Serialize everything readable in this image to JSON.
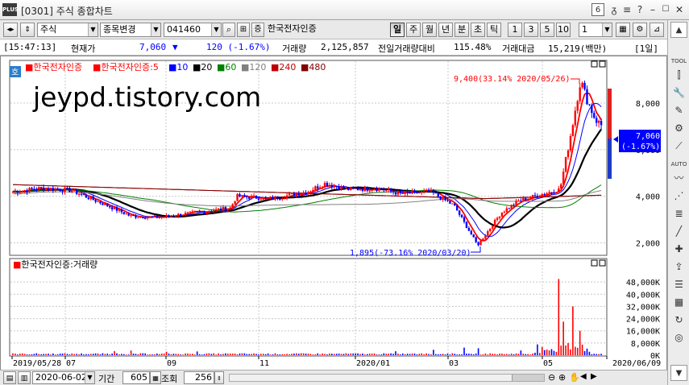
{
  "window": {
    "title": "[0301] 주식 종합차트",
    "window_number": "6",
    "title_icons": [
      "pin-icon",
      "menu-icon",
      "question-icon",
      "minimize-icon",
      "maximize-icon",
      "close-icon"
    ]
  },
  "toolbar": {
    "market_type": "주식",
    "change_stock_label": "종목변경",
    "stock_code": "041460",
    "stock_name": "한국전자인증",
    "period_buttons": [
      "일",
      "주",
      "월",
      "년",
      "분",
      "초",
      "틱"
    ],
    "active_period": "일",
    "interval_buttons": [
      "1",
      "3",
      "5",
      "10"
    ],
    "interval_value": "1"
  },
  "info": {
    "time": "[15:47:13]",
    "price_label": "현재가",
    "price": "7,060",
    "change_arrow": "▼",
    "change": "120  (-1.67%)",
    "volume_label": "거래량",
    "volume": "2,125,857",
    "prev_ratio_label": "전일거래량대비",
    "prev_ratio": "115.48%",
    "amount_label": "거래대금",
    "amount": "15,219(백만)",
    "period_tag": "[1일]"
  },
  "chart": {
    "stock_badge": "호",
    "watermark": "jeypd.tistory.com",
    "legend_name": "한국전자인증",
    "legend_ma_name": "한국전자인증:5",
    "legend_ma": [
      "10",
      "20",
      "60",
      "120",
      "240",
      "480"
    ],
    "high_annotation": "9,400(33.14% 2020/05/26)",
    "low_annotation": "1,895(-73.16% 2020/03/20)",
    "current_price_tag": "7,060",
    "current_change_tag": "(-1.67%)",
    "y_ticks": [
      "8,000",
      "6,000",
      "4,000",
      "2,000"
    ],
    "volume_title": "한국전자인증:거래량",
    "volume_ticks": [
      "48,000K",
      "40,000K",
      "32,000K",
      "24,000K",
      "16,000K",
      "8,000K",
      "0K"
    ],
    "x_ticks": [
      "2019/05/28",
      "07",
      "09",
      "11",
      "2020/01",
      "03",
      "05",
      "2020/06/09"
    ],
    "colors": {
      "up": "#ff0000",
      "down": "#0000ff",
      "ma5": "#ff0000",
      "ma10": "#0000ff",
      "ma20": "#000000",
      "ma60": "#008000",
      "ma120": "#808080",
      "ma240": "#c00000",
      "ma480": "#800000"
    }
  },
  "chart_data": {
    "type": "line",
    "title": "",
    "x": [
      "2019/05/28",
      "2019/07",
      "2019/09",
      "2019/11",
      "2020/01",
      "2020/03",
      "2020/03/20",
      "2020/05",
      "2020/05/26",
      "2020/06/09"
    ],
    "series": [
      {
        "name": "한국전자인증",
        "values": [
          4200,
          4300,
          3300,
          3900,
          4400,
          3800,
          1895,
          4300,
          9400,
          7060
        ]
      }
    ],
    "ylim": [
      1500,
      9800
    ],
    "y_ticks": [
      2000,
      4000,
      6000,
      8000
    ],
    "volume": {
      "name": "한국전자인증:거래량",
      "ylim": [
        0,
        56000
      ],
      "unit": "K"
    }
  },
  "bottom": {
    "date_value": "2020-06-02",
    "period_label": "기간",
    "period_value": "605",
    "lookup_label": "조회",
    "lookup_value": "256"
  },
  "rightbar": {
    "tool_label": "TOOL",
    "auto_label": "AUTO",
    "icons": [
      "up-arrow-icon",
      "candle-icon",
      "wrench-icon",
      "pen-icon",
      "chart-settings-icon",
      "trend-line-icon",
      "zoom-icon",
      "down-arrow-icon",
      "line-tool-icon",
      "fibonacci-icon",
      "fan-icon",
      "cursor-icon",
      "crosshair-icon",
      "wave-icon",
      "export-icon",
      "list-icon",
      "grid-icon",
      "refresh-icon",
      "target-icon",
      "down-arrow-icon"
    ]
  }
}
